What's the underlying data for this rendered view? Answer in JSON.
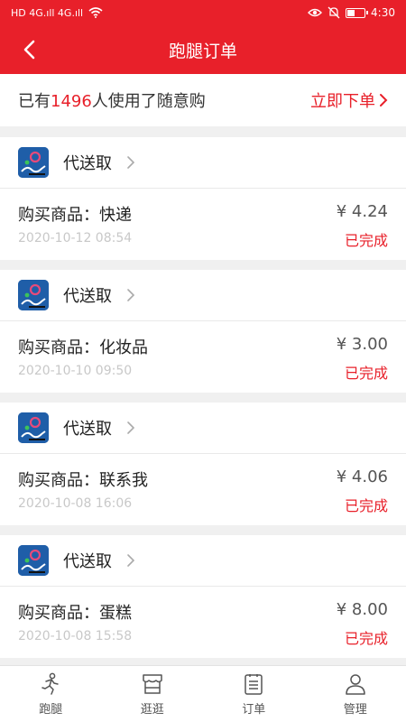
{
  "status_bar": {
    "left_glyphs": "HD 4G.ıll 4G.ıll",
    "time": "4:30"
  },
  "header": {
    "title": "跑腿订单"
  },
  "notice": {
    "prefix": "已有",
    "count": "1496",
    "suffix": "人使用了随意购",
    "action": "立即下单"
  },
  "orders": [
    {
      "shop": "代送取",
      "goods": "购买商品：快递",
      "time": "2020-10-12 08:54",
      "price": "¥ 4.24",
      "status": "已完成"
    },
    {
      "shop": "代送取",
      "goods": "购买商品：化妆品",
      "time": "2020-10-10 09:50",
      "price": "¥ 3.00",
      "status": "已完成"
    },
    {
      "shop": "代送取",
      "goods": "购买商品：联系我",
      "time": "2020-10-08 16:06",
      "price": "¥ 4.06",
      "status": "已完成"
    },
    {
      "shop": "代送取",
      "goods": "购买商品：蛋糕",
      "time": "2020-10-08 15:58",
      "price": "¥ 8.00",
      "status": "已完成"
    }
  ],
  "tabs": [
    {
      "label": "跑腿",
      "icon": "runner-icon"
    },
    {
      "label": "逛逛",
      "icon": "shop-icon"
    },
    {
      "label": "订单",
      "icon": "order-list-icon"
    },
    {
      "label": "管理",
      "icon": "user-icon"
    }
  ],
  "colors": {
    "accent": "#e8202a",
    "background": "#f0f0f0",
    "muted_text": "#c8c8c8"
  }
}
